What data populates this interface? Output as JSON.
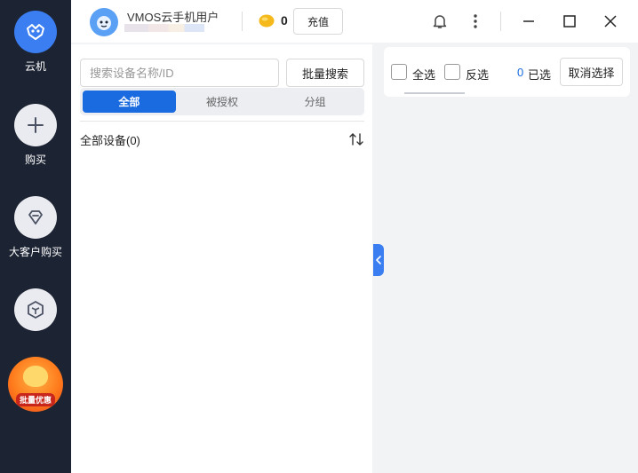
{
  "sidebar": {
    "items": [
      {
        "label": "云机",
        "icon": "cloud-phone-icon"
      },
      {
        "label": "购买",
        "icon": "plus-icon"
      },
      {
        "label": "大客户购买",
        "icon": "diamond-icon"
      },
      {
        "label": "",
        "icon": "cube-icon"
      }
    ],
    "promo_text": "批量优惠"
  },
  "header": {
    "username": "VMOS云手机用户",
    "coin_count": "0",
    "recharge_label": "充值"
  },
  "left_panel": {
    "search_placeholder": "搜索设备名称/ID",
    "batch_search_label": "批量搜索",
    "tabs": [
      "全部",
      "被授权",
      "分组"
    ],
    "all_devices_label": "全部设备(0)"
  },
  "right_panel": {
    "select_all_label": "全选",
    "invert_label": "反选",
    "selected_count": "0",
    "selected_label": "已选",
    "cancel_selection_label": "取消选择"
  },
  "colors": {
    "sidebar_bg": "#1c2333",
    "accent": "#1a6be0",
    "active_icon_bg": "#3a7ef2"
  }
}
